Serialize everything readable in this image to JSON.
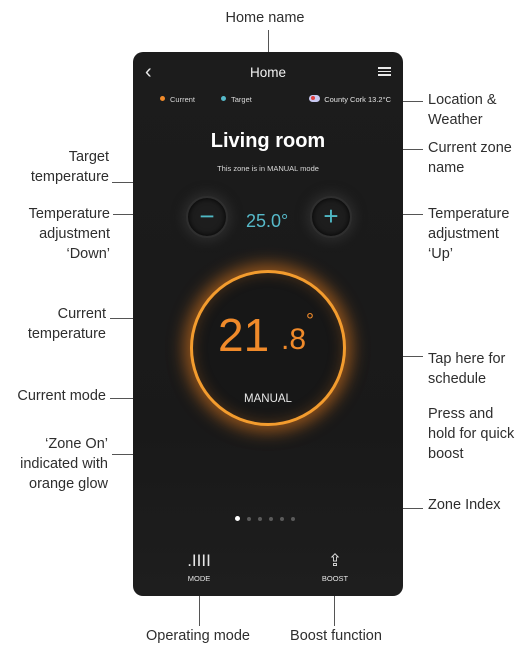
{
  "annotations": {
    "home_name": "Home name",
    "location_weather_1": "Location &",
    "location_weather_2": "Weather",
    "target_temp_1": "Target",
    "target_temp_2": "temperature",
    "zone_name_1": "Current zone",
    "zone_name_2": "name",
    "adj_down_1": "Temperature",
    "adj_down_2": "adjustment",
    "adj_down_3": "‘Down’",
    "adj_up_1": "Temperature",
    "adj_up_2": "adjustment",
    "adj_up_3": "‘Up’",
    "current_temp_1": "Current",
    "current_temp_2": "temperature",
    "tap_1": "Tap here for",
    "tap_2": "schedule",
    "current_mode": "Current mode",
    "press_1": "Press and",
    "press_2": "hold for quick",
    "press_3": "boost",
    "zone_on_1": "‘Zone On’",
    "zone_on_2": "indicated with",
    "zone_on_3": "orange glow",
    "zone_index": "Zone Index",
    "operating_mode": "Operating mode",
    "boost_function": "Boost function"
  },
  "app": {
    "back_icon": "chevron-left-icon",
    "title": "Home",
    "menu_icon": "hamburger-menu-icon",
    "legend": {
      "current": "Current",
      "target": "Target"
    },
    "colors": {
      "current": "#f08a2a",
      "target": "#56b9c9",
      "background": "#1a1a1a"
    },
    "weather": {
      "location": "County Cork",
      "temperature": "13.2°C",
      "icon": "weather-icon"
    },
    "zone": {
      "name": "Living room",
      "mode_text": "This zone is in MANUAL mode"
    },
    "target_temperature": "25.0°",
    "down_label": "−",
    "up_label": "+",
    "current_temperature": {
      "integer": "21",
      "decimal": ".8",
      "degree": "°",
      "value": 21.8
    },
    "ring_mode": "MANUAL",
    "pager": {
      "count": 6,
      "active": 0
    },
    "tabs": [
      {
        "icon": "radiator-icon",
        "glyph": ".IIII",
        "label": "MODE"
      },
      {
        "icon": "boost-arrow-icon",
        "glyph": "⇪",
        "label": "BOOST"
      }
    ]
  }
}
